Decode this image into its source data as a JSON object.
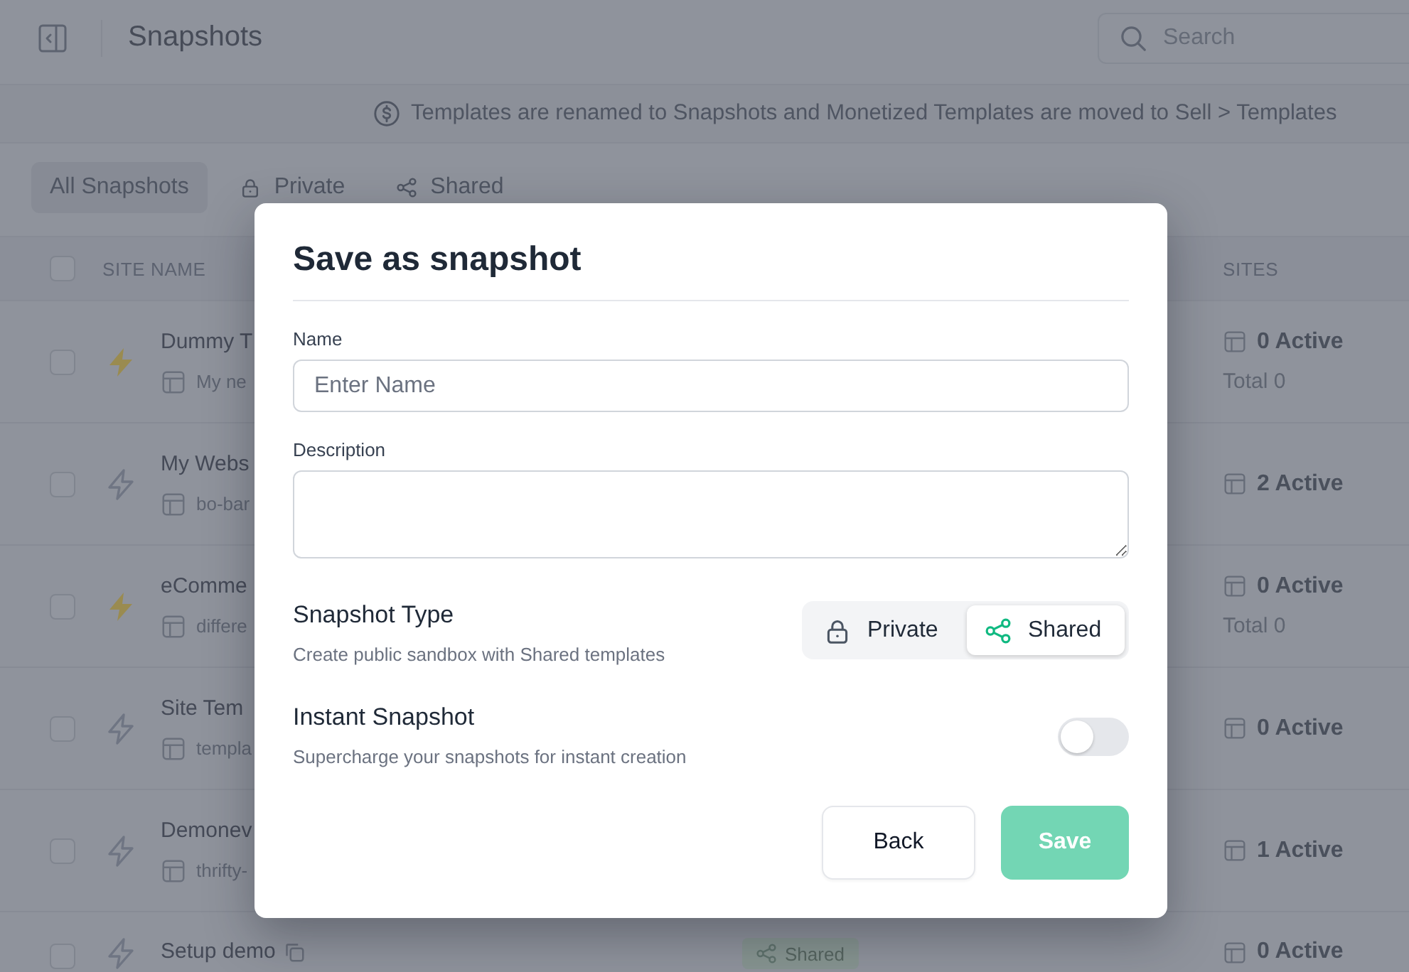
{
  "topbar": {
    "title": "Snapshots",
    "search": {
      "placeholder": "Search"
    }
  },
  "banner": {
    "text": "Templates are renamed to Snapshots and Monetized Templates are moved to Sell > Templates"
  },
  "tabs": [
    {
      "label": "All Snapshots",
      "kind": "all",
      "selected": true
    },
    {
      "label": "Private",
      "kind": "private",
      "selected": false
    },
    {
      "label": "Shared",
      "kind": "shared",
      "selected": false
    }
  ],
  "table": {
    "select_all_checked": false,
    "columns": [
      {
        "label": "SITE NAME"
      },
      {
        "label": "SITES"
      }
    ],
    "rows": [
      {
        "name": "Dummy T",
        "subtitle": "My ne",
        "instant": true,
        "copy": false,
        "checked": false,
        "active": "0 Active",
        "total": "Total 0"
      },
      {
        "name": "My Webs",
        "subtitle": "bo-bar",
        "instant": false,
        "copy": false,
        "checked": false,
        "active": "2 Active"
      },
      {
        "name": "eComme",
        "subtitle": "differe",
        "instant": true,
        "copy": false,
        "checked": false,
        "active": "0 Active",
        "total": "Total 0"
      },
      {
        "name": "Site Tem",
        "subtitle": "templa",
        "instant": false,
        "copy": false,
        "checked": false,
        "active": "0 Active"
      },
      {
        "name": "Demonev",
        "subtitle": "thrifty-",
        "instant": false,
        "copy": false,
        "checked": false,
        "active": "1 Active"
      },
      {
        "name": "Setup demo",
        "instant": false,
        "copy": true,
        "checked": false,
        "type": "Shared",
        "active": "0 Active"
      }
    ]
  },
  "dialog": {
    "title": "Save as snapshot",
    "name_field": {
      "label": "Name",
      "placeholder": "Enter Name"
    },
    "description_field": {
      "label": "Description"
    },
    "snapshot_type": {
      "title": "Snapshot Type",
      "description": "Create public sandbox with Shared templates",
      "options": [
        {
          "label": "Private",
          "kind": "private",
          "selected": false
        },
        {
          "label": "Shared",
          "kind": "shared",
          "selected": true
        }
      ]
    },
    "instant": {
      "title": "Instant Snapshot",
      "description": "Supercharge your snapshots for instant creation",
      "on": false
    },
    "buttons": [
      {
        "label": "Back",
        "kind": "back",
        "disabled": false
      },
      {
        "label": "Save",
        "kind": "save",
        "disabled": true
      }
    ]
  }
}
